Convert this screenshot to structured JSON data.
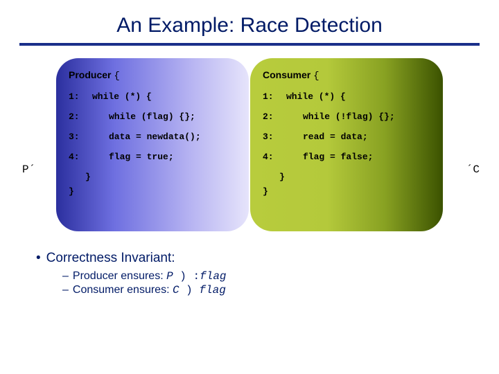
{
  "title": "An Example: Race Detection",
  "sideLabels": {
    "left": "P´",
    "right": "´C"
  },
  "producer": {
    "title": "Producer",
    "brace": "{",
    "lines": {
      "l1": {
        "n": "1:",
        "code": "while (*) {"
      },
      "l2": {
        "n": "2:",
        "code": "while (flag) {};"
      },
      "l3": {
        "n": "3:",
        "code": "data = newdata();"
      },
      "l4": {
        "n": "4:",
        "code": "flag = true;"
      }
    },
    "closeInner": "}",
    "closeOuter": "}"
  },
  "consumer": {
    "title": "Consumer",
    "brace": "{",
    "lines": {
      "l1": {
        "n": "1:",
        "code": "while (*)  {"
      },
      "l2": {
        "n": "2:",
        "code": "while (!flag) {};"
      },
      "l3": {
        "n": "3:",
        "code": "read = data;"
      },
      "l4": {
        "n": "4:",
        "code": "flag = false;"
      }
    },
    "closeInner": "}",
    "closeOuter": "}"
  },
  "bullets": {
    "main": "Correctness Invariant:",
    "sub1_pre": "Producer ensures: ",
    "sub1_sym": "P",
    "sub1_mid": " ) :",
    "sub1_flag": "flag",
    "sub2_pre": "Consumer ensures: ",
    "sub2_sym": "C",
    "sub2_mid": " ) ",
    "sub2_flag": "flag"
  }
}
